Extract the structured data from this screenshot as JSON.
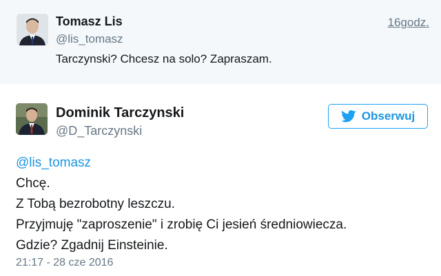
{
  "quoted_tweet": {
    "author_name": "Tomasz Lis",
    "author_handle": "@lis_tomasz",
    "time": "16godz.",
    "text": "Tarczynski? Chcesz na solo? Zapraszam."
  },
  "main_tweet": {
    "author_name": "Dominik Tarczynski",
    "author_handle": "@D_Tarczynski",
    "follow_label": "Obserwuj",
    "lines": [
      "@lis_tomasz",
      "Chcę.",
      "Z Tobą bezrobotny leszczu.",
      "Przyjmuję \"zaproszenie\" i zrobię Ci jesień średniowiecza.",
      "Gdzie? Zgadnij Einsteinie."
    ],
    "timestamp": "21:17 - 28 cze 2016"
  },
  "colors": {
    "accent": "#1da1f2",
    "link": "#1b95e0",
    "muted": "#657786",
    "text": "#14171a",
    "quoted_bg": "#f5f8fa"
  },
  "icons": {
    "follow": "twitter-bird-icon"
  }
}
